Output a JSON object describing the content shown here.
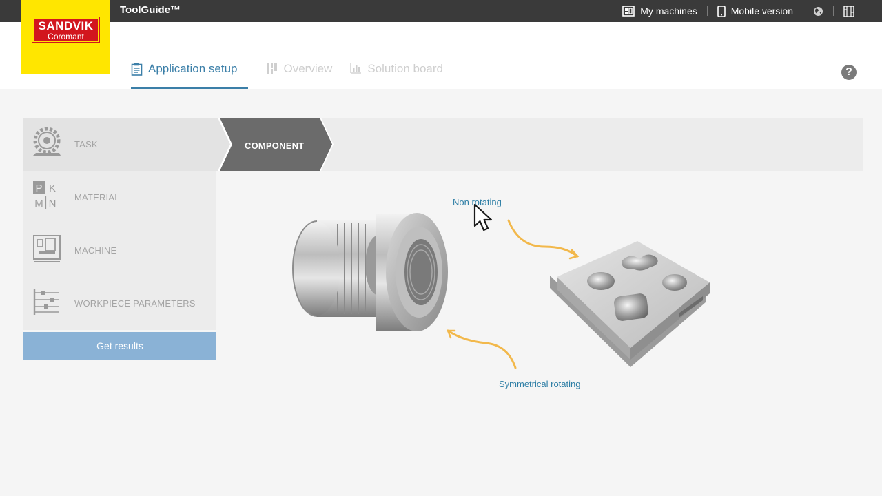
{
  "app": {
    "title": "ToolGuide™"
  },
  "topbar": {
    "my_machines": "My machines",
    "mobile_version": "Mobile version"
  },
  "logo": {
    "brand": "SANDVIK",
    "sub": "Coromant"
  },
  "tabs": [
    {
      "label": "Application setup",
      "state": "active"
    },
    {
      "label": "Overview",
      "state": "inactive"
    },
    {
      "label": "Solution board",
      "state": "inactive"
    }
  ],
  "help": "?",
  "sidebar": {
    "items": [
      {
        "label": "TASK"
      },
      {
        "label": "MATERIAL"
      },
      {
        "label": "MACHINE"
      },
      {
        "label": "WORKPIECE PARAMETERS"
      }
    ],
    "get_results": "Get results"
  },
  "breadcrumb": {
    "current": "COMPONENT"
  },
  "component_options": {
    "non_rotating": "Non rotating",
    "symmetrical_rotating": "Symmetrical rotating"
  },
  "material_letters": {
    "p": "P",
    "k": "K",
    "m": "M",
    "n": "N"
  },
  "colors": {
    "accent": "#3b7fa8",
    "button": "#8ab2d6",
    "logo_yellow": "#ffe600",
    "logo_red": "#d2161e",
    "arrow": "#f2b84b"
  }
}
